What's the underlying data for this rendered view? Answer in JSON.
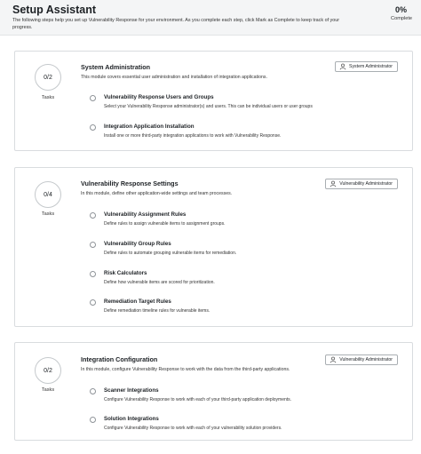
{
  "header": {
    "title": "Setup Assistant",
    "description": "The following steps help you set up Vulnerability Response for your environment. As you complete each step, click Mark as Complete to keep track of your progress.",
    "percent": "0%",
    "percent_label": "Complete"
  },
  "modules": [
    {
      "progress": "0/2",
      "tasks_label": "Tasks",
      "title": "System Administration",
      "description": "This module covers essential user administration and installation of integration applications.",
      "role_button": "System Administrator",
      "steps": [
        {
          "title": "Vulnerability Response Users and Groups",
          "description": "Select your Vulnerability Response administrator(s) and users. This can be individual users or user groups"
        },
        {
          "title": "Integration Application Installation",
          "description": "Install one or more third-party integration applications to work with Vulnerability Response."
        }
      ]
    },
    {
      "progress": "0/4",
      "tasks_label": "Tasks",
      "title": "Vulnerability Response Settings",
      "description": "In this module, define other application-wide settings and team processes.",
      "role_button": "Vulnerability Administrator",
      "steps": [
        {
          "title": "Vulnerability Assignment Rules",
          "description": "Define rules to assign vulnerable items to assignment groups."
        },
        {
          "title": "Vulnerability Group Rules",
          "description": "Define rules to automate grouping vulnerable items for remediation."
        },
        {
          "title": "Risk Calculators",
          "description": "Define how vulnerable items are scored for prioritization."
        },
        {
          "title": "Remediation Target Rules",
          "description": "Define remediation timeline rules for vulnerable items."
        }
      ]
    },
    {
      "progress": "0/2",
      "tasks_label": "Tasks",
      "title": "Integration Configuration",
      "description": "In this module, configure Vulnerability Response to work with the data from the third-party applications.",
      "role_button": "Vulnerability Administrator",
      "steps": [
        {
          "title": "Scanner Integrations",
          "description": "Configure Vulnerability Response to work with each of your third-party application deployments."
        },
        {
          "title": "Solution Integrations",
          "description": "Configure Vulnerability Response to work with each of your vulnerability solution providers."
        }
      ]
    }
  ],
  "icons": {
    "role_button": "user-icon",
    "step": "radio-circle-icon"
  }
}
